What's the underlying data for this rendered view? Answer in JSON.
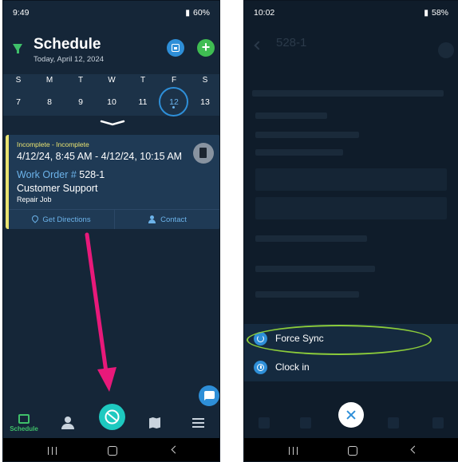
{
  "left_screen": {
    "status": {
      "time": "9:49",
      "battery": "60%"
    },
    "header": {
      "title": "Schedule",
      "date": "Today, April 12, 2024"
    },
    "week": {
      "days": [
        "S",
        "M",
        "T",
        "W",
        "T",
        "F",
        "S"
      ],
      "dates": [
        "7",
        "8",
        "9",
        "10",
        "11",
        "12",
        "13"
      ],
      "selected_index": 5
    },
    "card": {
      "status": "Incomplete - Incomplete",
      "time": "4/12/24, 8:45 AM - 4/12/24, 10:15 AM",
      "wo_label": "Work Order #",
      "wo_number": "528-1",
      "customer": "Customer Support",
      "job_type": "Repair Job",
      "directions_label": "Get Directions",
      "contact_label": "Contact"
    },
    "bottom_nav": {
      "schedule_label": "Schedule"
    }
  },
  "right_screen": {
    "status": {
      "time": "10:02",
      "battery": "58%"
    },
    "background_title": "528-1",
    "menu": [
      {
        "label": "Force Sync",
        "icon": "sync-icon"
      },
      {
        "label": "Clock in",
        "icon": "clock-icon"
      }
    ]
  },
  "colors": {
    "accent_green": "#3fc06a",
    "accent_blue": "#2e8fd8",
    "arrow_pink": "#e8197a",
    "highlight_green": "#8ccc3a",
    "card_status_yellow": "#e9e371"
  }
}
